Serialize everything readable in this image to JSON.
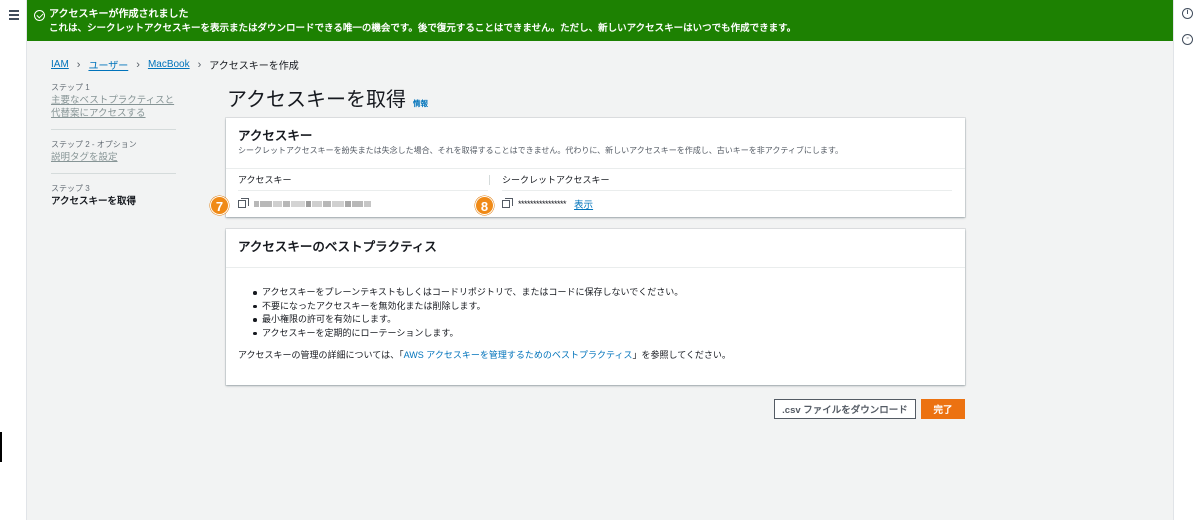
{
  "flash": {
    "title": "アクセスキーが作成されました",
    "message": "これは、シークレットアクセスキーを表示またはダウンロードできる唯一の機会です。後で復元することはできません。ただし、新しいアクセスキーはいつでも作成できます。"
  },
  "breadcrumb": {
    "items": [
      "IAM",
      "ユーザー",
      "MacBook"
    ],
    "current": "アクセスキーを作成"
  },
  "steps": [
    {
      "num": "ステップ 1",
      "label": "主要なベストプラクティスと代替案にアクセスする"
    },
    {
      "num": "ステップ 2 - オプション",
      "label": "説明タグを設定"
    },
    {
      "num": "ステップ 3",
      "label": "アクセスキーを取得"
    }
  ],
  "page": {
    "title": "アクセスキーを取得",
    "info": "情報"
  },
  "access_key_card": {
    "title": "アクセスキー",
    "description": "シークレットアクセスキーを紛失または失念した場合、それを取得することはできません。代わりに、新しいアクセスキーを作成し、古いキーを非アクティブにします。",
    "col_access_key": "アクセスキー",
    "col_secret_key": "シークレットアクセスキー",
    "secret_mask": "****************",
    "show_label": "表示",
    "badge_7": "7",
    "badge_8": "8"
  },
  "best_practices_card": {
    "title": "アクセスキーのベストプラクティス",
    "items": [
      "アクセスキーをプレーンテキストもしくはコードリポジトリで、またはコードに保存しないでください。",
      "不要になったアクセスキーを無効化または削除します。",
      "最小権限の許可を有効にします。",
      "アクセスキーを定期的にローテーションします。"
    ],
    "footer_prefix": "アクセスキーの管理の詳細については、「",
    "footer_link": "AWS アクセスキーを管理するためのベストプラクティス",
    "footer_suffix": "」を参照してください。"
  },
  "actions": {
    "download_csv": ".csv ファイルをダウンロード",
    "done": "完了"
  },
  "colors": {
    "flash_bg": "#1d8102",
    "link": "#0073bb",
    "primary_button": "#ec7211",
    "badge": "#f08a16"
  }
}
